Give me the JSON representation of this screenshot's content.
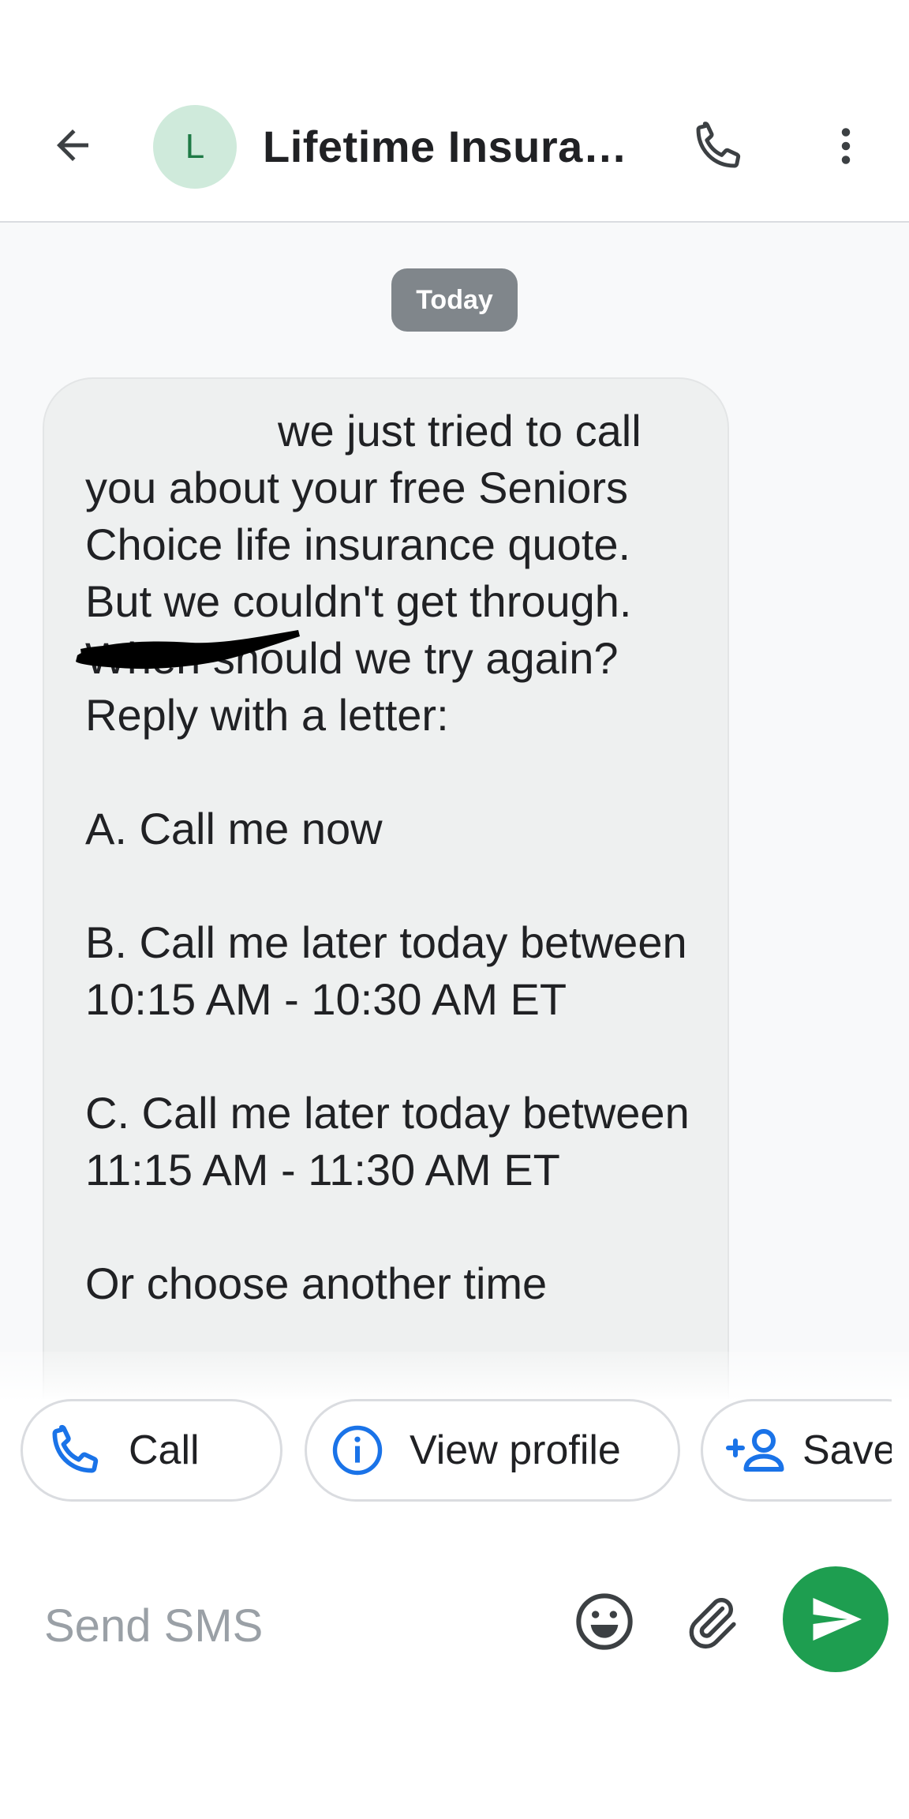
{
  "header": {
    "avatar_initial": "L",
    "contact_name": "Lifetime Insurance",
    "icons": {
      "back": "back-arrow-icon",
      "phone": "phone-icon",
      "more": "more-vert-icon"
    },
    "colors": {
      "avatar_bg": "#cfeadb",
      "avatar_fg": "#1e7a45"
    }
  },
  "conversation": {
    "date_label": "Today",
    "message": {
      "text": "we just tried to call you about your free Seniors Choice life insurance quote. But we couldn't get through. When should we try again? Reply with a letter:\n\nA. Call me now\n\nB. Call me later today between 10:15 AM - 10:30 AM ET\n\nC. Call me later today between 11:15 AM - 11:30 AM ET\n\nOr choose another time"
    },
    "scroll_down_icon": "double-chevron-down-icon"
  },
  "suggestions": [
    {
      "label": "Call",
      "icon": "phone-icon"
    },
    {
      "label": "View profile",
      "icon": "info-icon"
    },
    {
      "label": "Save",
      "icon": "add-person-icon"
    }
  ],
  "compose": {
    "placeholder": "Send SMS",
    "icons": {
      "emoji": "emoji-icon",
      "attach": "attach-icon",
      "send": "send-icon"
    },
    "colors": {
      "send_bg": "#1e9e50",
      "accent": "#1a73e8"
    }
  }
}
